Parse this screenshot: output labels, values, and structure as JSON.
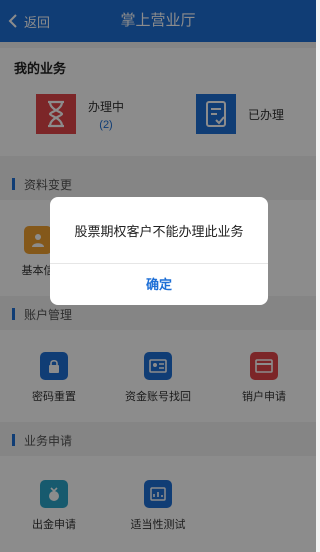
{
  "header": {
    "back_label": "返回",
    "title": "掌上营业厅"
  },
  "my_business": {
    "title": "我的业务",
    "processing": {
      "label": "办理中",
      "count": "(2)",
      "icon": "hourglass-icon"
    },
    "done": {
      "label": "已办理",
      "icon": "document-check-icon"
    }
  },
  "sections": {
    "profile": {
      "label": "资料变更",
      "items": [
        "基本信"
      ]
    },
    "account": {
      "label": "账户管理",
      "items": [
        "密码重置",
        "资金账号找回",
        "销户申请"
      ]
    },
    "business": {
      "label": "业务申请",
      "items": [
        "出金申请",
        "适当性测试"
      ]
    }
  },
  "dialog": {
    "message": "股票期权客户不能办理此业务",
    "confirm_label": "确定"
  },
  "colors": {
    "primary": "#1e6fd6",
    "red": "#e2454a",
    "overlay": "rgba(0,0,0,0.45)"
  }
}
